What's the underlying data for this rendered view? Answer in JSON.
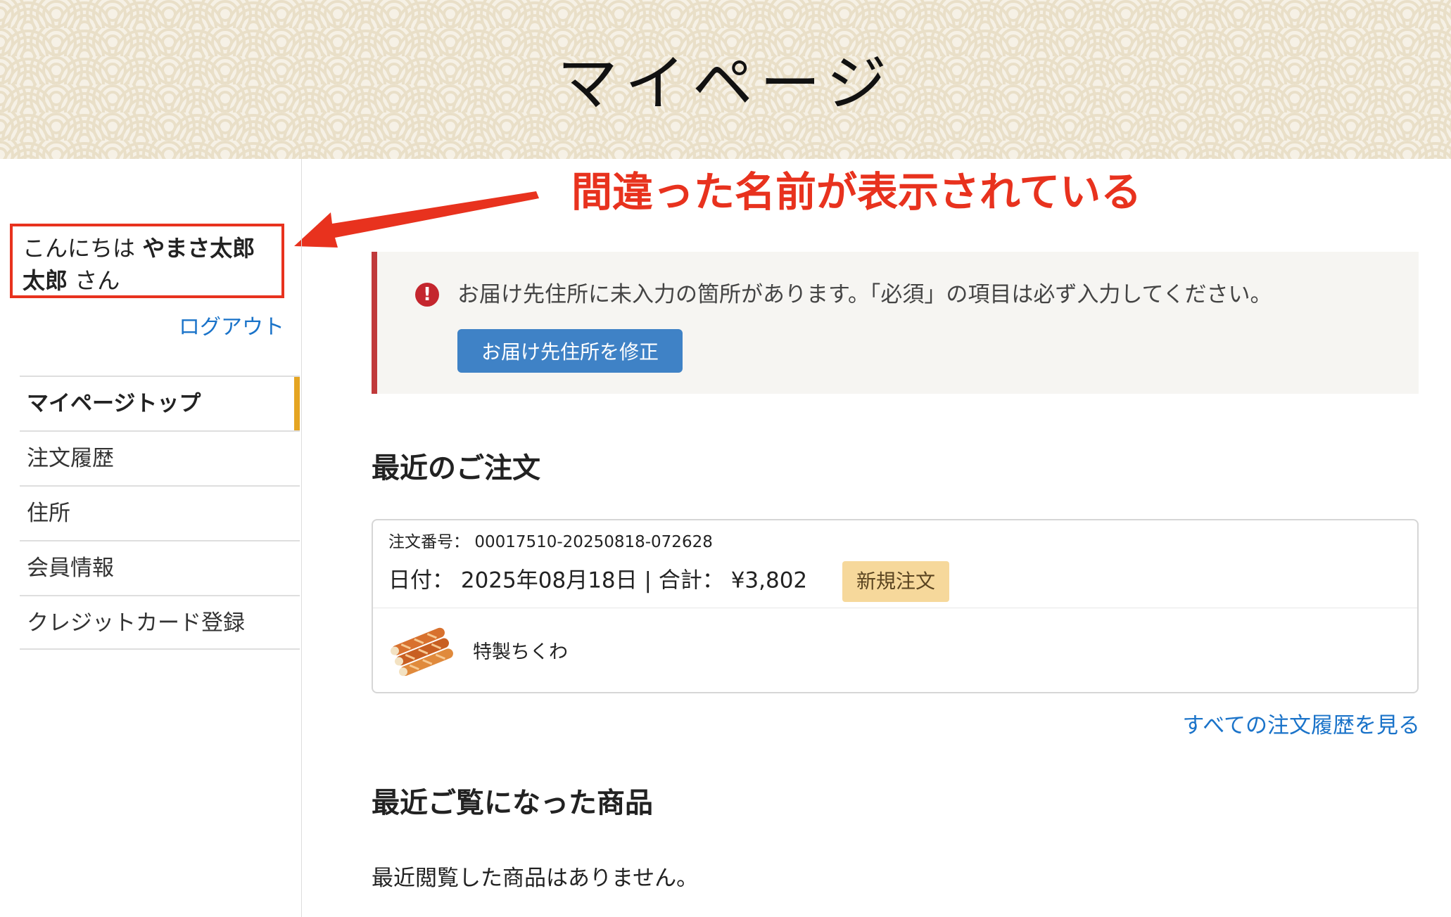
{
  "header": {
    "title": "マイページ"
  },
  "annotation": {
    "text": "間違った名前が表示されている",
    "color": "#e8321e"
  },
  "sidebar": {
    "greeting_prefix": "こんにちは",
    "user_name": "やまさ太郎 太郎",
    "greeting_suffix": "さん",
    "logout_label": "ログアウト",
    "nav_items": [
      {
        "label": "マイページトップ",
        "active": true
      },
      {
        "label": "注文履歴"
      },
      {
        "label": "住所"
      },
      {
        "label": "会員情報"
      },
      {
        "label": "クレジットカード登録"
      }
    ]
  },
  "alert": {
    "icon": "exclamation-icon",
    "message": "お届け先住所に未入力の箇所があります。「必須」の項目は必ず入力してください。",
    "button_label": "お届け先住所を修正"
  },
  "recent_orders": {
    "title": "最近のご注文",
    "order": {
      "number_label": "注文番号：",
      "number": "00017510-20250818-072628",
      "date_label": "日付：",
      "date": "2025年08月18日",
      "separator": "|",
      "total_label": "合計：",
      "total": "¥3,802",
      "status": "新規注文",
      "product_name": "特製ちくわ"
    },
    "view_all_label": "すべての注文履歴を見る"
  },
  "recently_viewed": {
    "title": "最近ご覧になった商品",
    "empty_text": "最近閲覧した商品はありません。"
  },
  "colors": {
    "accent_link": "#1a73c9",
    "alert_border": "#c0393b",
    "button_blue": "#3f82c6",
    "badge_bg": "#f6d89b",
    "nav_active_marker": "#e5a522",
    "header_bg": "#f6f1e6"
  }
}
